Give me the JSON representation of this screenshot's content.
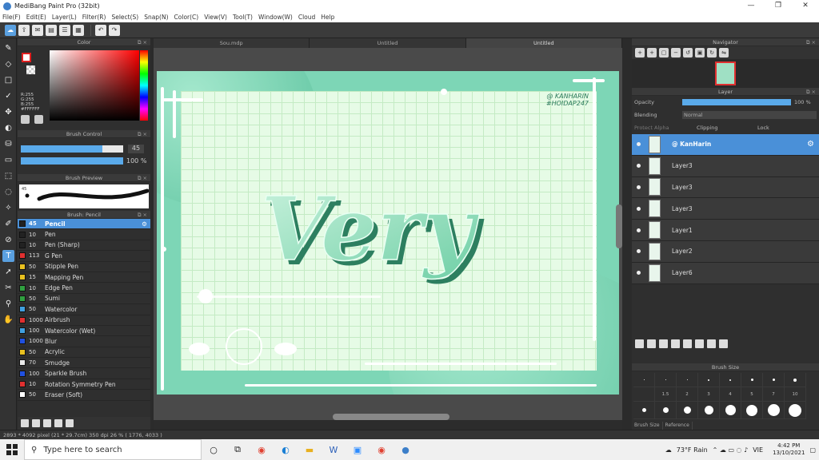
{
  "window": {
    "title": "MediBang Paint Pro (32bit)",
    "min": "—",
    "max": "❐",
    "close": "✕"
  },
  "menu": [
    "File(F)",
    "Edit(E)",
    "Layer(L)",
    "Filter(R)",
    "Select(S)",
    "Snap(N)",
    "Color(C)",
    "View(V)",
    "Tool(T)",
    "Window(W)",
    "Cloud",
    "Help"
  ],
  "color_panel": {
    "title": "Color",
    "rgb_text": [
      "R:255",
      "G:255",
      "B:255",
      "#FFFFFF"
    ],
    "fg_color": "#ffffff",
    "accent": "#e02020"
  },
  "brush_control": {
    "title": "Brush Control",
    "size": "45",
    "opacity": "100 %",
    "size_fraction": 0.8,
    "opacity_fraction": 1.0
  },
  "brush_preview": {
    "title": "Brush Preview",
    "label": "45"
  },
  "brush_panel": {
    "title": "Brush: Pencil",
    "items": [
      {
        "size": "45",
        "name": "Pencil",
        "color": "#222222",
        "selected": true
      },
      {
        "size": "10",
        "name": "Pen",
        "color": "#222222"
      },
      {
        "size": "10",
        "name": "Pen (Sharp)",
        "color": "#222222"
      },
      {
        "size": "113",
        "name": "G Pen",
        "color": "#e03030"
      },
      {
        "size": "50",
        "name": "Stipple Pen",
        "color": "#e8c020"
      },
      {
        "size": "15",
        "name": "Mapping Pen",
        "color": "#e8c020"
      },
      {
        "size": "10",
        "name": "Edge Pen",
        "color": "#30a040"
      },
      {
        "size": "50",
        "name": "Sumi",
        "color": "#30a040"
      },
      {
        "size": "50",
        "name": "Watercolor",
        "color": "#40a0e0"
      },
      {
        "size": "1000",
        "name": "Airbrush",
        "color": "#e03030"
      },
      {
        "size": "100",
        "name": "Watercolor (Wet)",
        "color": "#40a0e0"
      },
      {
        "size": "1000",
        "name": "Blur",
        "color": "#2050e0"
      },
      {
        "size": "50",
        "name": "Acrylic",
        "color": "#e8c020"
      },
      {
        "size": "70",
        "name": "Smudge",
        "color": "#e8e8e8"
      },
      {
        "size": "100",
        "name": "Sparkle Brush",
        "color": "#2050e0"
      },
      {
        "size": "10",
        "name": "Rotation Symmetry Pen",
        "color": "#e03030"
      },
      {
        "size": "50",
        "name": "Eraser (Soft)",
        "color": "#ffffff"
      }
    ]
  },
  "tabs": [
    {
      "label": "Sou.mdp",
      "active": false
    },
    {
      "label": "Untitled",
      "active": false
    },
    {
      "label": "Untitled",
      "active": true
    }
  ],
  "canvas": {
    "watermark_line1": "@ KANHARIN",
    "watermark_line2": "#HOIDAP247",
    "word": "Very",
    "bg": "#7dd6b6",
    "grid_bg": "#e6fbe6"
  },
  "navigator": {
    "title": "Navigator"
  },
  "layer_panel": {
    "title": "Layer",
    "opacity_label": "Opacity",
    "opacity_value": "100 %",
    "blending_label": "Blending",
    "blending_value": "Normal",
    "protect_alpha": "Protect Alpha",
    "clipping": "Clipping",
    "lock": "Lock",
    "layers": [
      {
        "name": "@ KanHarin",
        "selected": true
      },
      {
        "name": "Layer3"
      },
      {
        "name": "Layer3"
      },
      {
        "name": "Layer3"
      },
      {
        "name": "Layer1"
      },
      {
        "name": "Layer2"
      },
      {
        "name": "Layer6"
      }
    ]
  },
  "brush_size": {
    "title": "Brush Size",
    "labels": [
      "",
      "1.5",
      "2",
      "3",
      "4",
      "5",
      "7",
      "10"
    ],
    "tabs": [
      "Brush Size",
      "Reference"
    ]
  },
  "status": "2893 * 4092 pixel   (21 * 29.7cm)   350 dpi   26 %   ( 1776, 4033 )",
  "taskbar": {
    "search_placeholder": "Type here to search",
    "weather": "73°F  Rain",
    "lang": "VIE",
    "time": "4:42 PM",
    "date": "13/10/2021"
  }
}
